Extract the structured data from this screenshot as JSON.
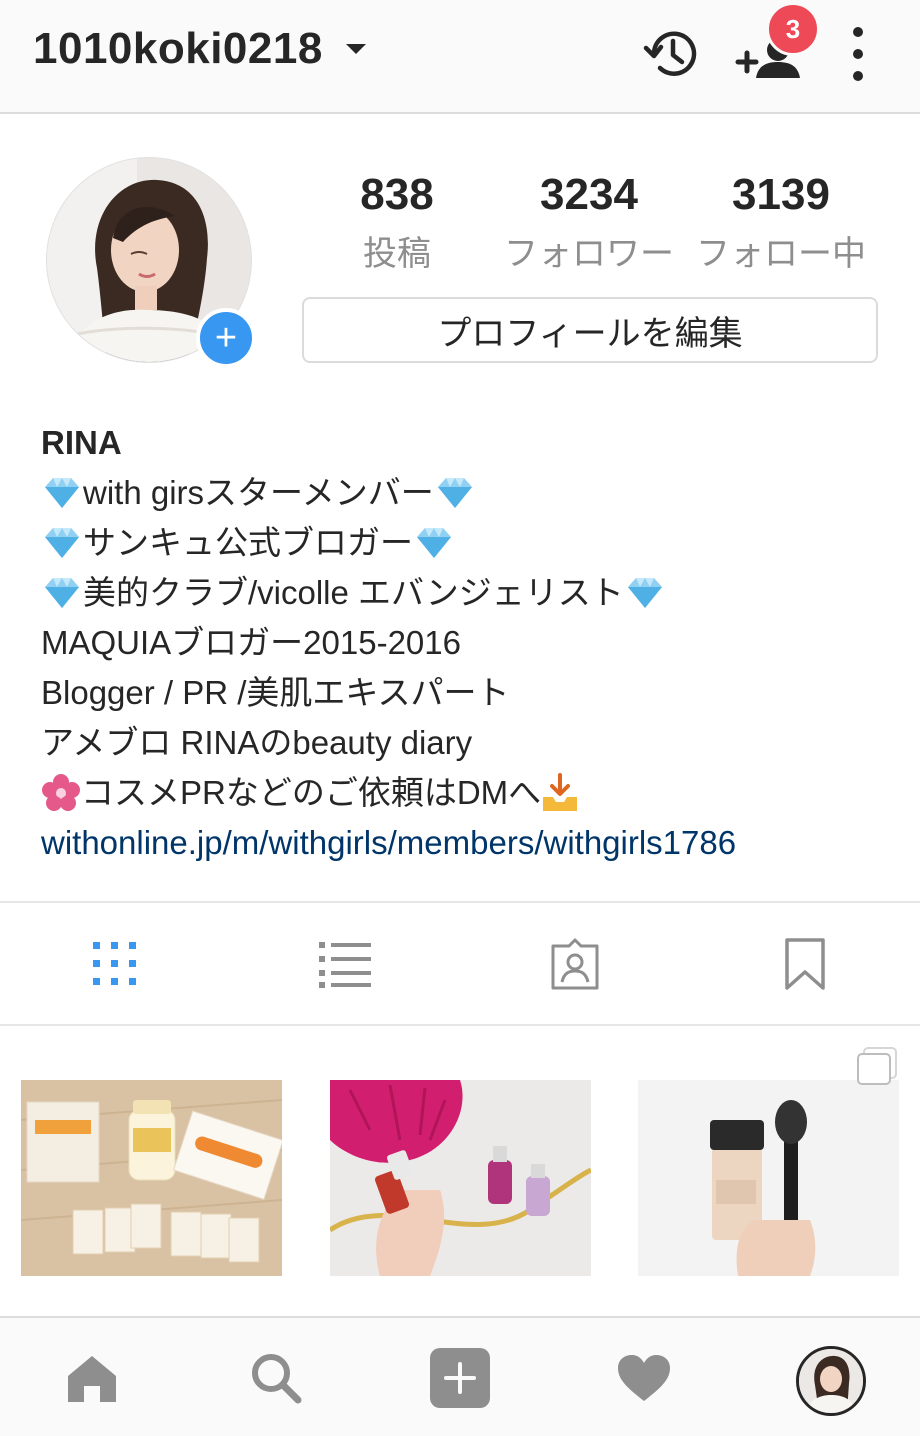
{
  "header": {
    "username": "1010koki0218",
    "notification_count": "3"
  },
  "profile": {
    "stats": [
      {
        "value": "838",
        "label": "投稿"
      },
      {
        "value": "3234",
        "label": "フォロワー"
      },
      {
        "value": "3139",
        "label": "フォロー中"
      }
    ],
    "edit_button": "プロフィールを編集"
  },
  "bio": {
    "name": "RINA",
    "line1": "with girsスターメンバー",
    "line2": "サンキュ公式ブロガー",
    "line3": "美的クラブ/vicolle エバンジェリスト",
    "line4": "MAQUIAブロガー2015-2016",
    "line5": "Blogger / PR /美肌エキスパート",
    "line6": "アメブロ RINAのbeauty diary",
    "line7": "コスメPRなどのご依頼はDMへ",
    "link": "withonline.jp/m/withgirls/members/withgirls1786"
  },
  "icons": {
    "history": "history-icon",
    "discover_people": "add-person-icon",
    "menu": "more-vertical-icon",
    "grid_tab": "grid-icon",
    "list_tab": "list-icon",
    "tagged_tab": "tagged-person-icon",
    "saved_tab": "bookmark-icon",
    "home": "home-icon",
    "search": "search-icon",
    "new_post": "plus-square-icon",
    "activity": "heart-icon"
  },
  "colors": {
    "accent_blue": "#3897f0",
    "badge_red": "#ed4956",
    "link": "#003569",
    "muted": "#8e8e8e"
  }
}
